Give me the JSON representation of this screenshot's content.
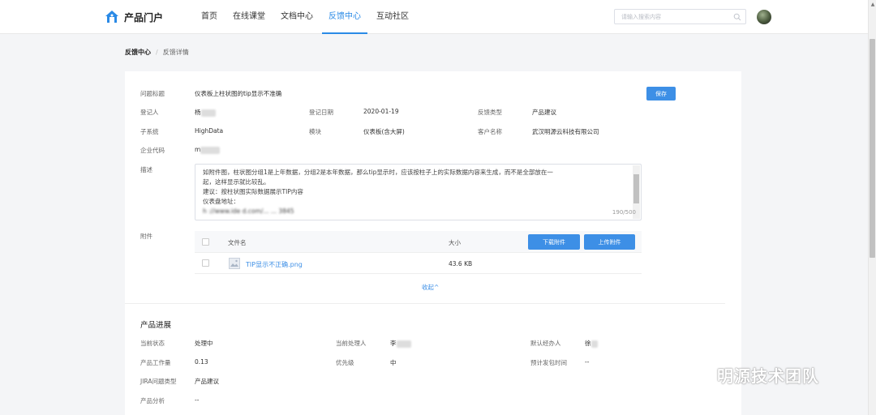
{
  "header": {
    "logo_text": "产品门户",
    "nav": [
      "首页",
      "在线课堂",
      "文档中心",
      "反馈中心",
      "互动社区"
    ],
    "active_nav": "反馈中心",
    "search_placeholder": "请输入搜索内容"
  },
  "breadcrumb": {
    "root": "反馈中心",
    "separator": "/",
    "current": "反馈详情"
  },
  "form": {
    "title_label": "问题标题",
    "title_value": "仪表板上柱状图的tip显示不准确",
    "save_label": "保存",
    "registrant_label": "登记人",
    "registrant_value": "杨",
    "date_label": "登记日期",
    "date_value": "2020-01-19",
    "type_label": "反馈类型",
    "type_value": "产品建议",
    "subsystem_label": "子系统",
    "subsystem_value": "HighData",
    "module_label": "模块",
    "module_value": "仪表板(含大屏)",
    "customer_label": "客户名称",
    "customer_value": "武汉明源云科技有限公司",
    "corp_code_label": "企业代码",
    "corp_code_value": "m",
    "desc_label": "描述",
    "desc_lines": [
      "如附件图，柱状图分组1是上年数据，分组2是本年数据，那么tip显示时，应该按柱子上的实际数据内容来生成，而不是全部放在一",
      "起，这样显示就比较乱。",
      "建议：按柱状图实际数据展示TIP内容",
      "仪表盘地址：",
      "h    ://www.ide      d.com/...          ...          3845        "
    ],
    "desc_count": "190/500"
  },
  "attachments": {
    "label": "附件",
    "col_name": "文件名",
    "col_size": "大小",
    "download_label": "下载附件",
    "upload_label": "上传附件",
    "files": [
      {
        "name": "TIP显示不正确.png",
        "size": "43.6 KB"
      }
    ],
    "collapse_label": "收起^"
  },
  "progress": {
    "title": "产品进展",
    "status_label": "当前状态",
    "status_value": "处理中",
    "handler_label": "当前处理人",
    "handler_value": "李",
    "default_agent_label": "默认经办人",
    "default_agent_value": "徐",
    "workload_label": "产品工作量",
    "workload_value": "0.13",
    "priority_label": "优先级",
    "priority_value": "中",
    "release_label": "预计发包时间",
    "release_value": "--",
    "jira_label": "JIRA问题类型",
    "jira_value": "产品建议",
    "analysis_label": "产品分析",
    "analysis_value": "--"
  },
  "watermark_text": "明源技术团队",
  "colors": {
    "accent": "#3d8fe6"
  }
}
